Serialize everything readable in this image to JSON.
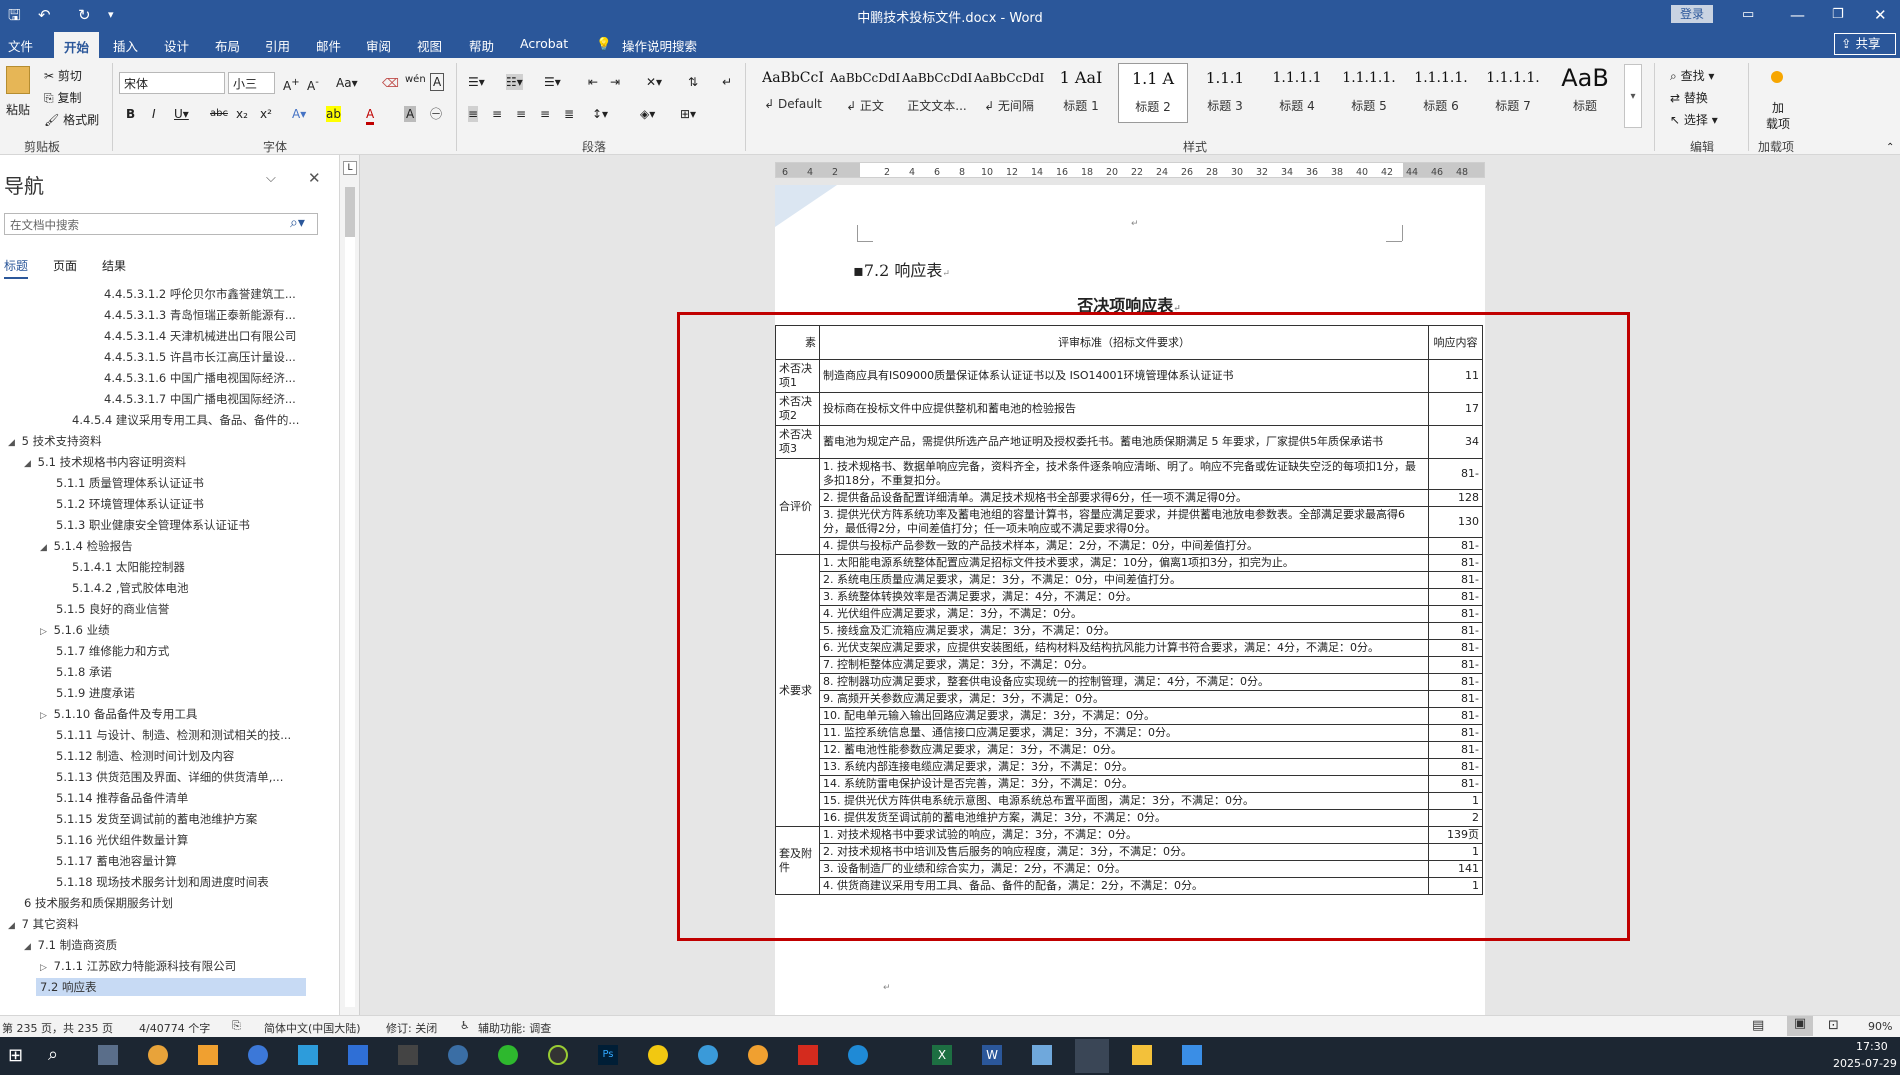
{
  "window": {
    "title": "中鹏技术投标文件.docx  -  Word",
    "login": "登录"
  },
  "menu": {
    "tabs": [
      "文件",
      "开始",
      "插入",
      "设计",
      "布局",
      "引用",
      "邮件",
      "审阅",
      "视图",
      "帮助",
      "Acrobat"
    ],
    "active_tab": "开始",
    "tell_me": "操作说明搜索",
    "share": "共享"
  },
  "ribbon": {
    "clipboard": {
      "paste": "粘贴",
      "cut": "剪切",
      "copy": "复制",
      "format_painter": "格式刷",
      "label": "剪贴板"
    },
    "font": {
      "name": "宋体",
      "size": "小三",
      "label": "字体"
    },
    "paragraph": {
      "label": "段落"
    },
    "styles": {
      "label": "样式",
      "items": [
        {
          "preview": "AaBbCcI",
          "name": "↲ Default"
        },
        {
          "preview": "AaBbCcDdI",
          "name": "↲ 正文"
        },
        {
          "preview": "AaBbCcDdI",
          "name": "正文文本..."
        },
        {
          "preview": "AaBbCcDdI",
          "name": "↲ 无间隔"
        },
        {
          "preview": "1  AaI",
          "name": "标题 1"
        },
        {
          "preview": "1.1  A",
          "name": "标题 2"
        },
        {
          "preview": "1.1.1",
          "name": "标题 3"
        },
        {
          "preview": "1.1.1.1",
          "name": "标题 4"
        },
        {
          "preview": "1.1.1.1.",
          "name": "标题 5"
        },
        {
          "preview": "1.1.1.1.",
          "name": "标题 6"
        },
        {
          "preview": "1.1.1.1.",
          "name": "标题 7"
        },
        {
          "preview": "AaB",
          "name": "标题"
        }
      ],
      "selected": "标题 2"
    },
    "editing": {
      "find": "查找",
      "replace": "替换",
      "select": "选择",
      "label": "编辑"
    },
    "addins": {
      "load": "加",
      "load2": "载项",
      "label": "加载项"
    }
  },
  "nav": {
    "title": "导航",
    "search_placeholder": "在文档中搜索",
    "tabs": [
      "标题",
      "页面",
      "结果"
    ],
    "items": [
      {
        "text": "4.4.5.3.1.2 呼伦贝尔市鑫誉建筑工..."
      },
      {
        "text": "4.4.5.3.1.3 青岛恒瑞正泰新能源有..."
      },
      {
        "text": "4.4.5.3.1.4 天津机械进出口有限公司"
      },
      {
        "text": "4.4.5.3.1.5 许昌市长江高压计量设..."
      },
      {
        "text": "4.4.5.3.1.6 中国广播电视国际经济..."
      },
      {
        "text": "4.4.5.3.1.7 中国广播电视国际经济..."
      },
      {
        "text": "4.4.5.4 建议采用专用工具、备品、备件的..."
      },
      {
        "text": "5 技术支持资料"
      },
      {
        "text": "5.1 技术规格书内容证明资料"
      },
      {
        "text": "5.1.1 质量管理体系认证证书"
      },
      {
        "text": "5.1.2 环境管理体系认证证书"
      },
      {
        "text": "5.1.3 职业健康安全管理体系认证证书"
      },
      {
        "text": "5.1.4 检验报告"
      },
      {
        "text": "5.1.4.1 太阳能控制器"
      },
      {
        "text": "5.1.4.2 ,管式胶体电池"
      },
      {
        "text": "5.1.5 良好的商业信誉"
      },
      {
        "text": "5.1.6 业绩"
      },
      {
        "text": "5.1.7 维修能力和方式"
      },
      {
        "text": "5.1.8 承诺"
      },
      {
        "text": "5.1.9 进度承诺"
      },
      {
        "text": "5.1.10 备品备件及专用工具"
      },
      {
        "text": "5.1.11 与设计、制造、检测和测试相关的技..."
      },
      {
        "text": "5.1.12 制造、检测时间计划及内容"
      },
      {
        "text": "5.1.13 供货范围及界面、详细的供货清单,..."
      },
      {
        "text": "5.1.14 推荐备品备件清单"
      },
      {
        "text": "5.1.15 发货至调试前的蓄电池维护方案"
      },
      {
        "text": "5.1.16 光伏组件数量计算"
      },
      {
        "text": "5.1.17 蓄电池容量计算"
      },
      {
        "text": "5.1.18 现场技术服务计划和周进度时间表"
      },
      {
        "text": "6 技术服务和质保期服务计划"
      },
      {
        "text": "7 其它资料"
      },
      {
        "text": "7.1 制造商资质"
      },
      {
        "text": "7.1.1 江苏欧力特能源科技有限公司"
      },
      {
        "text": "7.2 响应表"
      }
    ]
  },
  "document": {
    "heading": "7.2    响应表",
    "table_title": "否决项响应表",
    "header": {
      "c1": "素",
      "c2": "评审标准（招标文件要求）",
      "c3": "响应内容"
    },
    "rows": [
      {
        "c1": "术否决项1",
        "c2": "制造商应具有IS09000质量保证体系认证证书以及 ISO14001环境管理体系认证证书",
        "c3": "11"
      },
      {
        "c1": "术否决项2",
        "c2": "投标商在投标文件中应提供整机和蓄电池的检验报告",
        "c3": "17"
      },
      {
        "c1": "术否决项3",
        "c2": "蓄电池为规定产品，需提供所选产品产地证明及授权委托书。蓄电池质保期满足 5 年要求，厂家提供5年质保承诺书",
        "c3": "34"
      },
      {
        "c1": "合评价",
        "c2": "1. 技术规格书、数据单响应完备，资料齐全，技术条件逐条响应清晰、明了。响应不完备或佐证缺失空泛的每项扣1分，最多扣18分，不重复扣分。",
        "c3": "81-"
      },
      {
        "c1": "",
        "c2": "2. 提供备品设备配置详细清单。满足技术规格书全部要求得6分，任一项不满足得0分。",
        "c3": "128"
      },
      {
        "c1": "",
        "c2": "3. 提供光伏方阵系统功率及蓄电池组的容量计算书，容量应满足要求，并提供蓄电池放电参数表。全部满足要求最高得6分，最低得2分，中间差值打分；任一项未响应或不满足要求得0分。",
        "c3": "130"
      },
      {
        "c1": "",
        "c2": "4. 提供与投标产品参数一致的产品技术样本，满足：2分，不满足：0分，中间差值打分。",
        "c3": "81-"
      },
      {
        "c1": "术要求",
        "c2": "1. 太阳能电源系统整体配置应满足招标文件技术要求，满足：10分，偏离1项扣3分，扣完为止。",
        "c3": "81-"
      },
      {
        "c1": "",
        "c2": "2. 系统电压质量应满足要求，满足：3分，不满足：0分，中间差值打分。",
        "c3": "81-"
      },
      {
        "c1": "",
        "c2": "3. 系统整体转换效率是否满足要求，满足：4分，不满足：0分。",
        "c3": "81-"
      },
      {
        "c1": "",
        "c2": "4. 光伏组件应满足要求，满足：3分，不满足：0分。",
        "c3": "81-"
      },
      {
        "c1": "",
        "c2": "5. 接线盒及汇流箱应满足要求，满足：3分，不满足：0分。",
        "c3": "81-"
      },
      {
        "c1": "",
        "c2": "6. 光伏支架应满足要求，应提供安装图纸，结构材料及结构抗风能力计算书符合要求，满足：4分，不满足：0分。",
        "c3": "81-"
      },
      {
        "c1": "",
        "c2": "7.  控制柜整体应满足要求，满足：3分，不满足：0分。",
        "c3": "81-"
      },
      {
        "c1": "",
        "c2": "8. 控制器功应满足要求，整套供电设备应实现统一的控制管理，满足：4分，不满足：0分。",
        "c3": "81-"
      },
      {
        "c1": "",
        "c2": "9.  高频开关参数应满足要求，满足：3分，不满足：0分。",
        "c3": "81-"
      },
      {
        "c1": "",
        "c2": "10. 配电单元输入输出回路应满足要求，满足：3分，不满足：0分。",
        "c3": "81-"
      },
      {
        "c1": "",
        "c2": "11.  监控系统信息量、通信接口应满足要求，满足：3分，不满足：0分。",
        "c3": "81-"
      },
      {
        "c1": "",
        "c2": "12.  蓄电池性能参数应满足要求，满足：3分，不满足：0分。",
        "c3": "81-"
      },
      {
        "c1": "",
        "c2": "13. 系统内部连接电缆应满足要求，满足：3分，不满足：0分。",
        "c3": "81-"
      },
      {
        "c1": "",
        "c2": "14.  系统防雷电保护设计是否完善，满足：3分，不满足：0分。",
        "c3": "81-"
      },
      {
        "c1": "",
        "c2": "15. 提供光伏方阵供电系统示意图、电源系统总布置平面图，满足：3分，不满足：0分。",
        "c3": "1"
      },
      {
        "c1": "",
        "c2": "16.  提供发货至调试前的蓄电池维护方案，满足：3分，不满足：0分。",
        "c3": "2"
      },
      {
        "c1": "套及附件",
        "c2": "1.  对技术规格书中要求试验的响应，满足：3分，不满足：0分。",
        "c3": "139页"
      },
      {
        "c1": "",
        "c2": "2.  对技术规格书中培训及售后服务的响应程度，满足：3分，不满足：0分。",
        "c3": "1"
      },
      {
        "c1": "",
        "c2": "3.  设备制造厂的业绩和综合实力，满足：2分，不满足：0分。",
        "c3": "141"
      },
      {
        "c1": "",
        "c2": "4.  供货商建议采用专用工具、备品、备件的配备，满足：2分，不满足：0分。",
        "c3": "1"
      }
    ]
  },
  "ruler": {
    "numbers": [
      "6",
      "4",
      "2",
      "",
      "2",
      "4",
      "6",
      "8",
      "10",
      "12",
      "14",
      "16",
      "18",
      "20",
      "22",
      "24",
      "26",
      "28",
      "30",
      "32",
      "34",
      "36",
      "38",
      "40",
      "42",
      "44",
      "46",
      "48"
    ]
  },
  "status": {
    "page": "第 235 页，共 235 页",
    "words": "4/40774 个字",
    "lang": "简体中文(中国大陆)",
    "track": "修订: 关闭",
    "accessibility": "辅助功能: 调查",
    "zoom": "90%"
  },
  "taskbar": {
    "time": "17:30",
    "date": "2025-07-29"
  },
  "colors": {
    "word_blue": "#2b579a",
    "highlight_red": "#c00000"
  }
}
